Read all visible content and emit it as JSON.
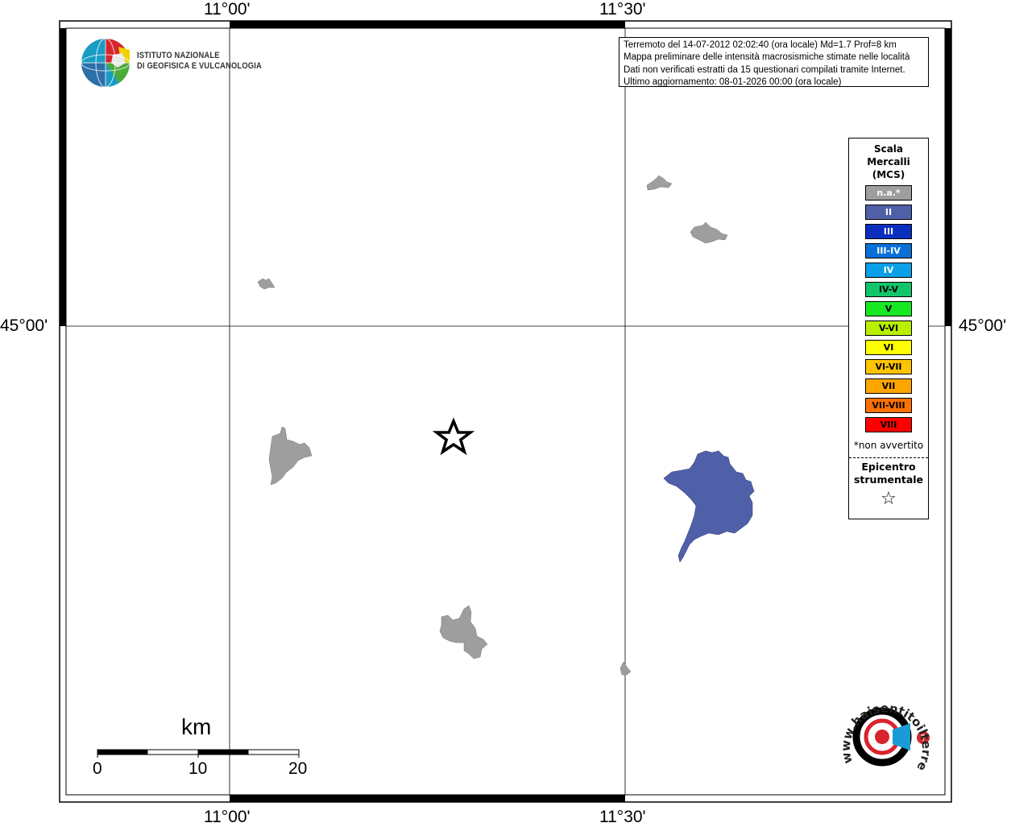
{
  "map": {
    "lon_labels": [
      "11°00'",
      "11°30'"
    ],
    "lat_labels": [
      "45°00'"
    ],
    "colors": {
      "frame": "#000000",
      "grid": "#000000",
      "locality_na": "#9e9e9e",
      "locality_II": "#5060a8"
    },
    "localities": [
      {
        "intensity": "n.a.*",
        "color": "#9e9e9e"
      },
      {
        "intensity": "n.a.*",
        "color": "#9e9e9e"
      },
      {
        "intensity": "n.a.*",
        "color": "#9e9e9e"
      },
      {
        "intensity": "n.a.*",
        "color": "#9e9e9e"
      },
      {
        "intensity": "n.a.*",
        "color": "#9e9e9e"
      },
      {
        "intensity": "n.a.*",
        "color": "#9e9e9e"
      },
      {
        "intensity": "II",
        "color": "#5060a8"
      }
    ],
    "epicenter_symbol": "star-icon"
  },
  "logo": {
    "icon": "ingv-globe-icon",
    "line1": "ISTITUTO NAZIONALE",
    "line2": "DI GEOFISICA E VULCANOLOGIA"
  },
  "info": {
    "line1": "Terremoto del 14-07-2012 02:02:40 (ora locale) Md=1.7 Prof=8 km",
    "line2": "Mappa preliminare delle intensità macrosismiche stimate nelle località",
    "line3": "Dati non verificati estratti da 15 questionari compilati tramite Internet.",
    "line4": "Ultimo aggiornamento: 08-01-2026 00:00 (ora locale)"
  },
  "legend": {
    "title_line1": "Scala",
    "title_line2": "Mercalli",
    "title_line3": "(MCS)",
    "items": [
      {
        "label": "n.a.*",
        "color": "#9e9e9e",
        "text_color": "light"
      },
      {
        "label": "II",
        "color": "#5060a8",
        "text_color": "light"
      },
      {
        "label": "III",
        "color": "#0a2fbf",
        "text_color": "light"
      },
      {
        "label": "III-IV",
        "color": "#0a6fd6",
        "text_color": "light"
      },
      {
        "label": "IV",
        "color": "#0a9fe8",
        "text_color": "light"
      },
      {
        "label": "IV-V",
        "color": "#12c46a",
        "text_color": "dark"
      },
      {
        "label": "V",
        "color": "#18e824",
        "text_color": "dark"
      },
      {
        "label": "V-VI",
        "color": "#b8f000",
        "text_color": "dark"
      },
      {
        "label": "VI",
        "color": "#ffff00",
        "text_color": "dark"
      },
      {
        "label": "VI-VII",
        "color": "#ffc400",
        "text_color": "dark"
      },
      {
        "label": "VII",
        "color": "#ffa500",
        "text_color": "dark"
      },
      {
        "label": "VII-VIII",
        "color": "#ff7000",
        "text_color": "dark"
      },
      {
        "label": "VIII",
        "color": "#ff0000",
        "text_color": "dark"
      }
    ],
    "note": "*non avvertito",
    "epicenter_line1": "Epicentro",
    "epicenter_line2": "strumentale",
    "epicenter_symbol": "☆"
  },
  "scale_bar": {
    "title": "km",
    "ticks": [
      "0",
      "10",
      "20"
    ]
  },
  "watermark": {
    "icon": "haisentito-logo-icon",
    "text": "www.haisentitoilterremoto.it"
  }
}
